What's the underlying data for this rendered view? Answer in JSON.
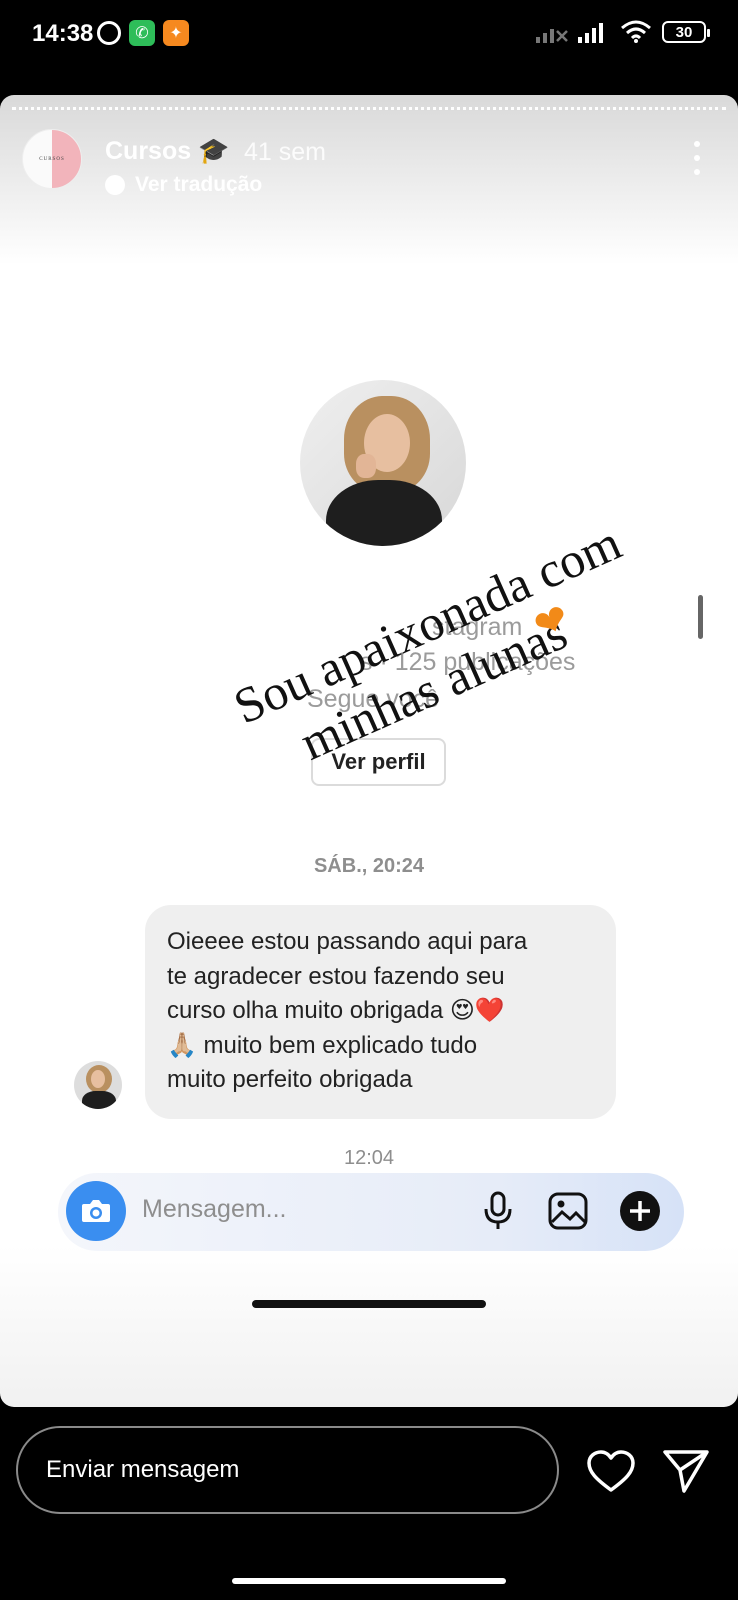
{
  "status_bar": {
    "time": "14:38",
    "battery": "30",
    "icons": [
      "alarm-icon",
      "phone-app-icon",
      "notification-app-icon",
      "signal-off-icon",
      "signal-icon",
      "wifi-icon",
      "battery-icon"
    ]
  },
  "story": {
    "username": "Cursos 🎓",
    "time_ago": "41 sem",
    "translate_label": "Ver tradução",
    "avatar_text": "CURSOS",
    "overlay_line1": "Sou apaixonada com",
    "overlay_line2": "minhas alunas",
    "overlay_heart": "❤",
    "overlay_heart_color": "#f28a18"
  },
  "screenshot": {
    "profile_line1": "stagram",
    "profile_line2": "s · 125 publicações",
    "profile_line3": "Segue você",
    "view_profile_button": "Ver perfil",
    "date_separator": "SÁB., 20:24",
    "message_lines": [
      "Oieeee estou passando aqui para",
      "te agradecer estou fazendo seu",
      "curso olha muito obrigada 😍❤️",
      "🙏🏼 muito bem explicado tudo",
      "muito perfeito obrigada"
    ],
    "time_separator": "12:04",
    "composer_placeholder": "Mensagem...",
    "camera_button_color": "#3a8ef0"
  },
  "reply_bar": {
    "placeholder": "Enviar mensagem"
  }
}
